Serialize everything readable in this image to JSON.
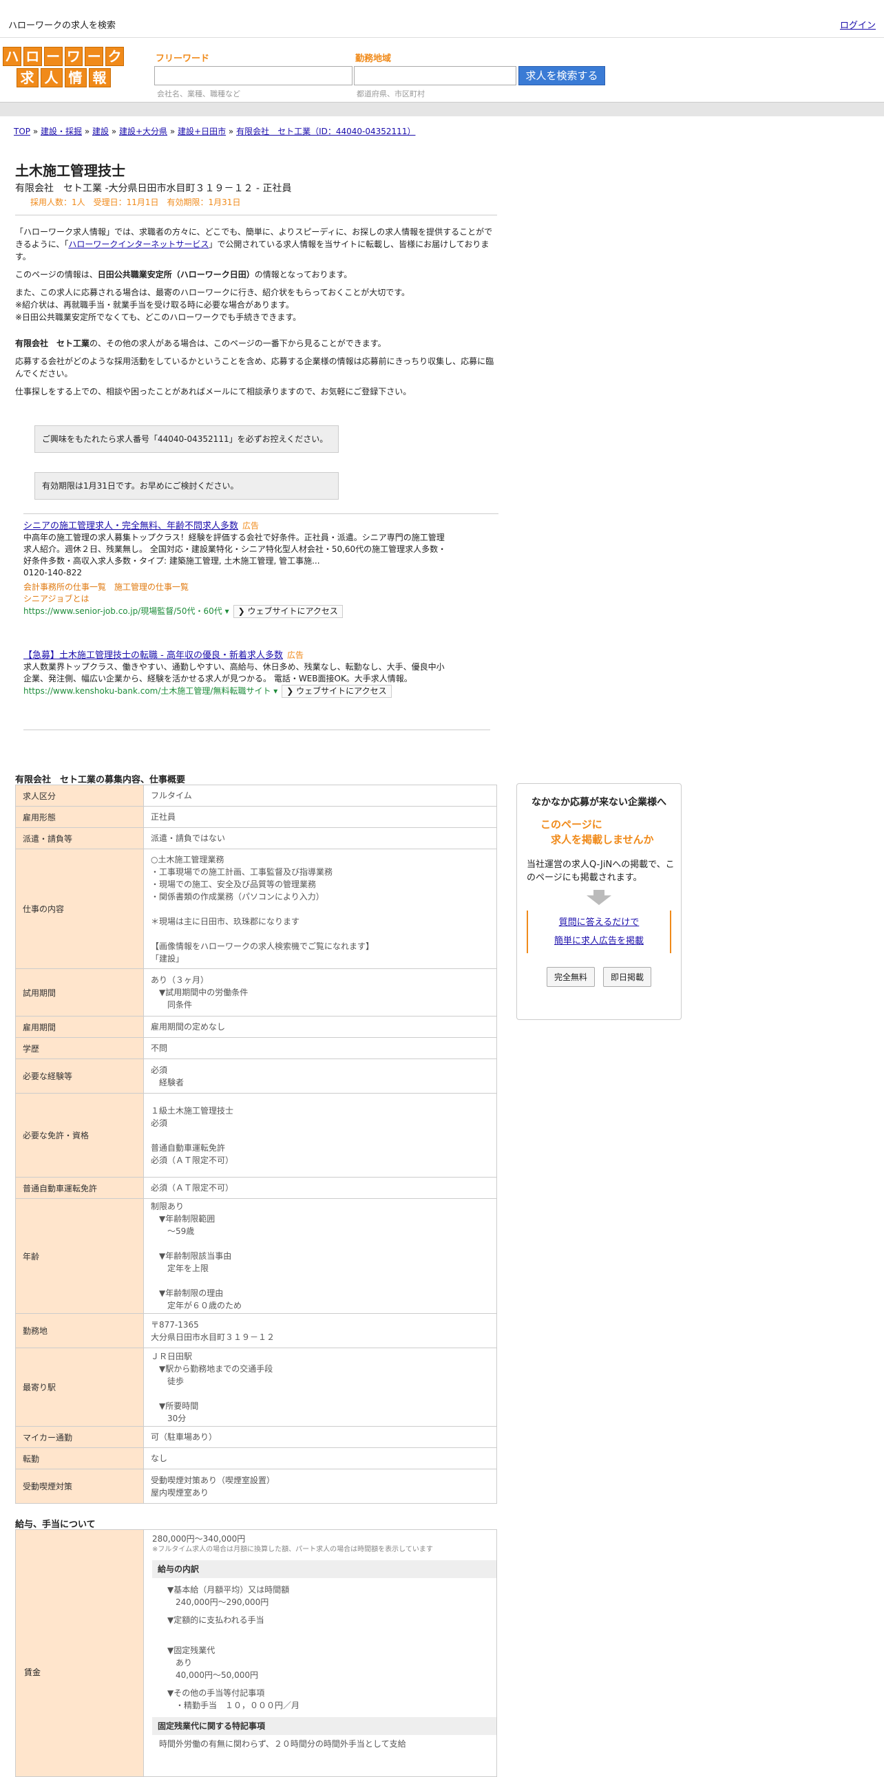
{
  "topbar": {
    "site_title": "ハローワークの求人を検索",
    "login": "ログイン"
  },
  "logo": {
    "row1": [
      "ハ",
      "ロ",
      "ー",
      "ワ",
      "ー",
      "ク"
    ],
    "row2": [
      "求",
      "人",
      "情",
      "報"
    ]
  },
  "search": {
    "keyword_label": "フリーワード",
    "keyword_placeholder": "会社名、業種、職種など",
    "area_label": "勤務地域",
    "area_placeholder": "都道府県、市区町村",
    "button": "求人を検索する"
  },
  "breadcrumb": [
    "TOP",
    "建設・採掘",
    "建設",
    "建設+大分県",
    "建設+日田市",
    "有限会社　セト工業（ID：44040-04352111）"
  ],
  "job": {
    "title": "土木施工管理技士",
    "subtitle": "有限会社　セト工業 -大分県日田市水目町３１９－１２ - 正社員",
    "stats": "採用人数：1人　受理日：11月1日　有効期限：1月31日"
  },
  "intro": {
    "p1_a": "「ハローワーク求人情報」では、求職者の方々に、どこでも、簡単に、よりスピーディに、お探しの求人情報を提供することができるように、「",
    "p1_link": "ハローワークインターネットサービス",
    "p1_b": "」で公開されている求人情報を当サイトに転載し、皆様にお届けしております。",
    "p2_a": "このページの情報は、",
    "p2_bold": "日田公共職業安定所（ハローワーク日田）",
    "p2_b": "の情報となっております。",
    "p3": "また、この求人に応募される場合は、最寄のハローワークに行き、紹介状をもらっておくことが大切です。",
    "p4": "※紹介状は、再就職手当・就業手当を受け取る時に必要な場合があります。",
    "p5": "※日田公共職業安定所でなくても、どこのハローワークでも手続きできます。",
    "p6_bold": "有限会社　セト工業",
    "p6_b": "の、その他の求人がある場合は、このページの一番下から見ることができます。",
    "p7": "応募する会社がどのような採用活動をしているかということを含め、応募する企業様の情報は応募前にきっちり収集し、応募に臨んでください。",
    "p8": "仕事探しをする上での、相談や困ったことがあればメールにて相談承りますので、お気軽にご登録下さい。"
  },
  "notices": {
    "n1": "ご興味をもたれたら求人番号「44040-04352111」を必ずお控えください。",
    "n2": "有効期限は1月31日です。お早めにご検討ください。"
  },
  "ads": [
    {
      "title": "シニアの施工管理求人・完全無料、年齢不問求人多数",
      "badge": "広告",
      "body": "中高年の施工管理の求人募集トップクラス！経験を評価する会社で好条件。正社員・派遣。シニア専門の施工管理求人紹介。週休２日、残業無し。 全国対応・建設業特化・シニア特化型人材会社・50,60代の施工管理求人多数・好条件多数・高収入求人多数・タイプ: 建築施工管理, 土木施工管理, 管工事施...",
      "phone": "0120-140-822",
      "links": "会計事務所の仕事一覧　施工管理の仕事一覧",
      "link2": "シニアジョブとは",
      "url": "https://www.senior-job.co.jp/現場監督/50代・60代",
      "visit": "ウェブサイトにアクセス"
    },
    {
      "title": "【急募】土木施工管理技士の転職 - 高年収の優良・新着求人多数",
      "badge": "広告",
      "body": "求人数業界トップクラス、働きやすい、通勤しやすい、高給与、休日多め、残業なし、転勤なし、大手、優良中小企業、発注側、幅広い企業から、経験を活かせる求人が見つかる。 電話・WEB面接OK。大手求人情報。",
      "url": "https://www.kenshoku-bank.com/土木施工管理/無料転職サイト",
      "visit": "ウェブサイトにアクセス"
    }
  ],
  "overview_heading": "有限会社　セト工業の募集内容、仕事概要",
  "overview": [
    {
      "label": "求人区分",
      "value": "フルタイム"
    },
    {
      "label": "雇用形態",
      "value": "正社員"
    },
    {
      "label": "派遣・請負等",
      "value": "派遣・請負ではない"
    },
    {
      "label": "仕事の内容",
      "value": "○土木施工管理業務\n・工事現場での施工計画、工事監督及び指導業務\n・現場での施工、安全及び品質等の管理業務\n・関係書類の作成業務（パソコンにより入力）\n\n＊現場は主に日田市、玖珠郡になります\n\n【画像情報をハローワークの求人検索機でご覧になれます】\n「建設」"
    },
    {
      "label": "試用期間",
      "value": "あり（３ヶ月）\n　▼試用期間中の労働条件\n　　同条件"
    },
    {
      "label": "雇用期間",
      "value": "雇用期間の定めなし"
    },
    {
      "label": "学歴",
      "value": "不問"
    },
    {
      "label": "必要な経験等",
      "value": "必須\n　経験者"
    },
    {
      "label": "必要な免許・資格",
      "value": "１級土木施工管理技士\n必須\n\n普通自動車運転免許\n必須（ＡＴ限定不可）"
    },
    {
      "label": "普通自動車運転免許",
      "value": "必須（ＡＴ限定不可）"
    },
    {
      "label": "年齢",
      "value": "制限あり\n　▼年齢制限範囲\n　　〜59歳\n\n　▼年齢制限該当事由\n　　定年を上限\n\n　▼年齢制限の理由\n　　定年が６０歳のため"
    },
    {
      "label": "勤務地",
      "value": "〒877-1365\n大分県日田市水目町３１９－１２"
    },
    {
      "label": "最寄り駅",
      "value": "ＪＲ日田駅\n　▼駅から勤務地までの交通手段\n　　徒歩\n\n　▼所要時間\n　　30分"
    },
    {
      "label": "マイカー通勤",
      "value": "可（駐車場あり）"
    },
    {
      "label": "転勤",
      "value": "なし"
    },
    {
      "label": "受動喫煙対策",
      "value": "受動喫煙対策あり（喫煙室設置）\n屋内喫煙室あり"
    }
  ],
  "sidebar": {
    "title": "なかなか応募が来ない企業様へ",
    "catch1": "このページに",
    "catch2": "　求人を掲載しませんか",
    "desc": "当社運営の求人Q-JiNへの掲載で、このページにも掲載されます。",
    "link1": "質問に答えるだけで",
    "link2": "簡単に求人広告を掲載",
    "btn1": "完全無料",
    "btn2": "即日掲載"
  },
  "salary": {
    "heading": "給与、手当について",
    "label": "賃金",
    "range": "280,000円〜340,000円",
    "note": "※フルタイム求人の場合は月額に換算した額、パート求人の場合は時間額を表示しています",
    "breakdown_head": "給与の内訳",
    "b1": "▼基本給（月額平均）又は時間額\n　240,000円〜290,000円",
    "b2": "▼定額的に支払われる手当",
    "b3": "▼固定残業代\n　あり\n　40,000円〜50,000円",
    "b4": "▼その他の手当等付記事項\n　・精勤手当　１０，０００円／月",
    "ot_head": "固定残業代に関する特記事項",
    "ot_text": "時間外労働の有無に関わらず、２０時間分の時間外手当として支給"
  }
}
